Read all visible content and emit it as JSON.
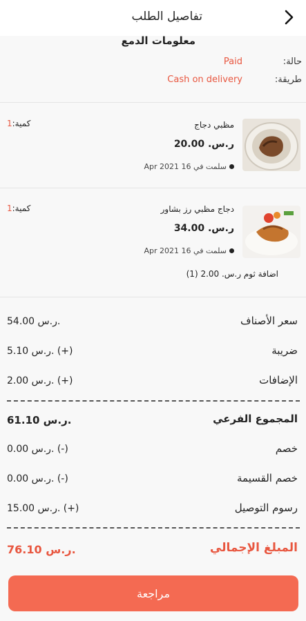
{
  "header": {
    "title": "تفاصيل الطلب",
    "back_icon": "chevron-left-icon"
  },
  "payment": {
    "section_title": "معلومات الدمع",
    "status_label": "حالة:",
    "status_value": "Paid",
    "method_label": "طريقة:",
    "method_value": "Cash on delivery"
  },
  "items": [
    {
      "name": "مظبي دجاج",
      "price": "ر.س. 20.00",
      "delivered": "سلمت في 16 Apr 2021",
      "qty_label": "كمية:",
      "qty": "1"
    },
    {
      "name": "دجاج مظبي رز بشاور",
      "price": "ر.س. 34.00",
      "delivered": "سلمت في 16 Apr 2021",
      "qty_label": "كمية:",
      "qty": "1",
      "addon": "اضافة ثوم ر.س. 2.00 (1)"
    }
  ],
  "summary": {
    "items_price_label": "سعر الأصناف",
    "items_price": "54.00 ر.س.",
    "tax_label": "ضريبة",
    "tax": "5.10 ر.س. (+)",
    "addons_label": "الإضافات",
    "addons": "2.00 ر.س. (+)",
    "subtotal_label": "المجموع الفرعي",
    "subtotal": "61.10 ر.س.",
    "discount_label": "خصم",
    "discount": "0.00 ر.س. (-)",
    "coupon_label": "خصم القسيمة",
    "coupon": "0.00 ر.س. (-)",
    "delivery_label": "رسوم التوصيل",
    "delivery": "15.00 ر.س. (+)",
    "total_label": "المبلغ الإجمالي",
    "total": "76.10 ر.س."
  },
  "review_button": "مراجعة",
  "colors": {
    "accent": "#e8563f",
    "button": "#f46a52"
  }
}
